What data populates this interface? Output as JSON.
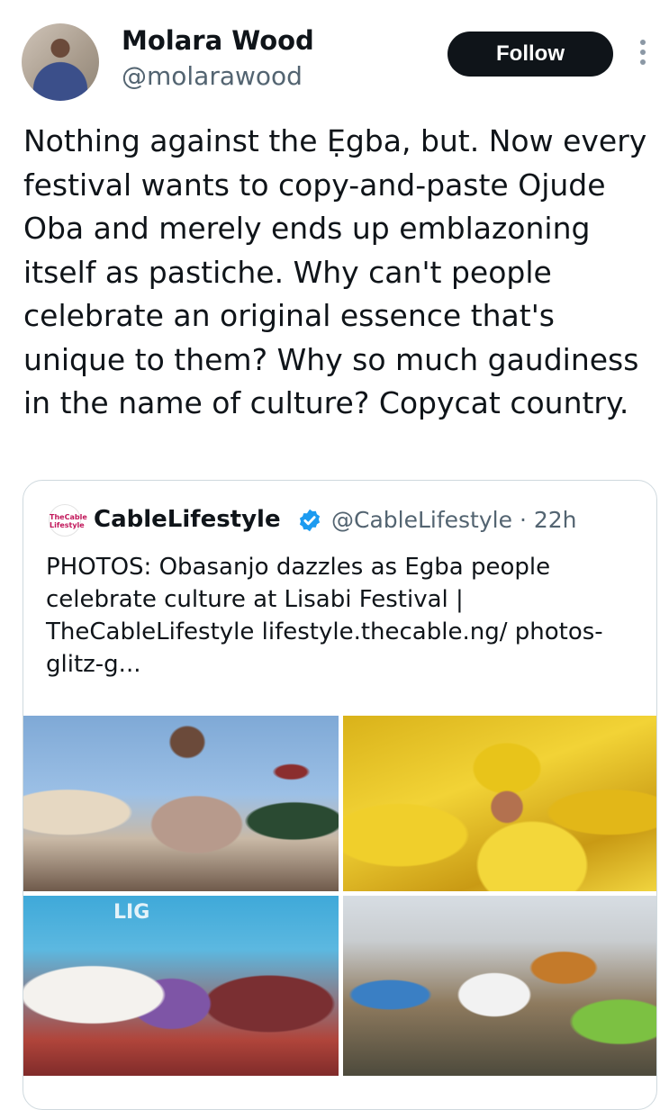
{
  "author": {
    "name": "Molara Wood",
    "handle": "@molarawood",
    "follow_label": "Follow"
  },
  "tweet": {
    "text": "Nothing against the Ẹgba, but. Now every festival wants to copy-and-paste Ojude Oba and merely ends up emblazoning itself as pastiche. Why can't people celebrate an original essence that's unique to them? Why so much gaudiness in the name of culture? Copycat country."
  },
  "quote": {
    "logo_text": "TheCable Lifestyle",
    "name": "CableLifestyle",
    "handle": "@CableLifestyle",
    "separator": "·",
    "time": "22h",
    "text": "PHOTOS: Obasanjo dazzles as Egba people celebrate culture at Lisabi Festival | TheCableLifestyle   lifestyle.thecable.ng/ photos-glitz-g...",
    "photo3_sign": "LIG",
    "icons": {
      "verified": "verified-badge-icon",
      "more": "more-vertical-icon"
    },
    "colors": {
      "verified": "#1d9bf0",
      "follow_bg": "#0f1419",
      "muted": "#536471"
    }
  }
}
